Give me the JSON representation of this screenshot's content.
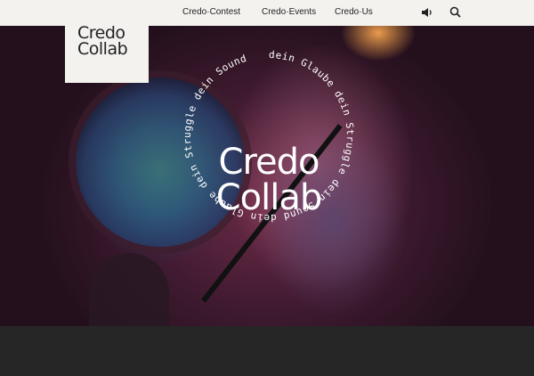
{
  "nav": {
    "links": [
      "Credo·Contest",
      "Credo·Events",
      "Credo·Us"
    ]
  },
  "logo": {
    "line1": "Credo",
    "line2": "Collab"
  },
  "hero": {
    "title_line1": "Credo",
    "title_line2": "Collab",
    "ring_text": "dein Glaube dein Struggle dein Sound dein Glaube dein Struggle dein Sound"
  },
  "icons": {
    "sound": "speaker-icon",
    "search": "search-icon"
  },
  "colors": {
    "topbar": "#f3f2ef",
    "dark": "#262626",
    "accent_text": "#ffffff"
  }
}
